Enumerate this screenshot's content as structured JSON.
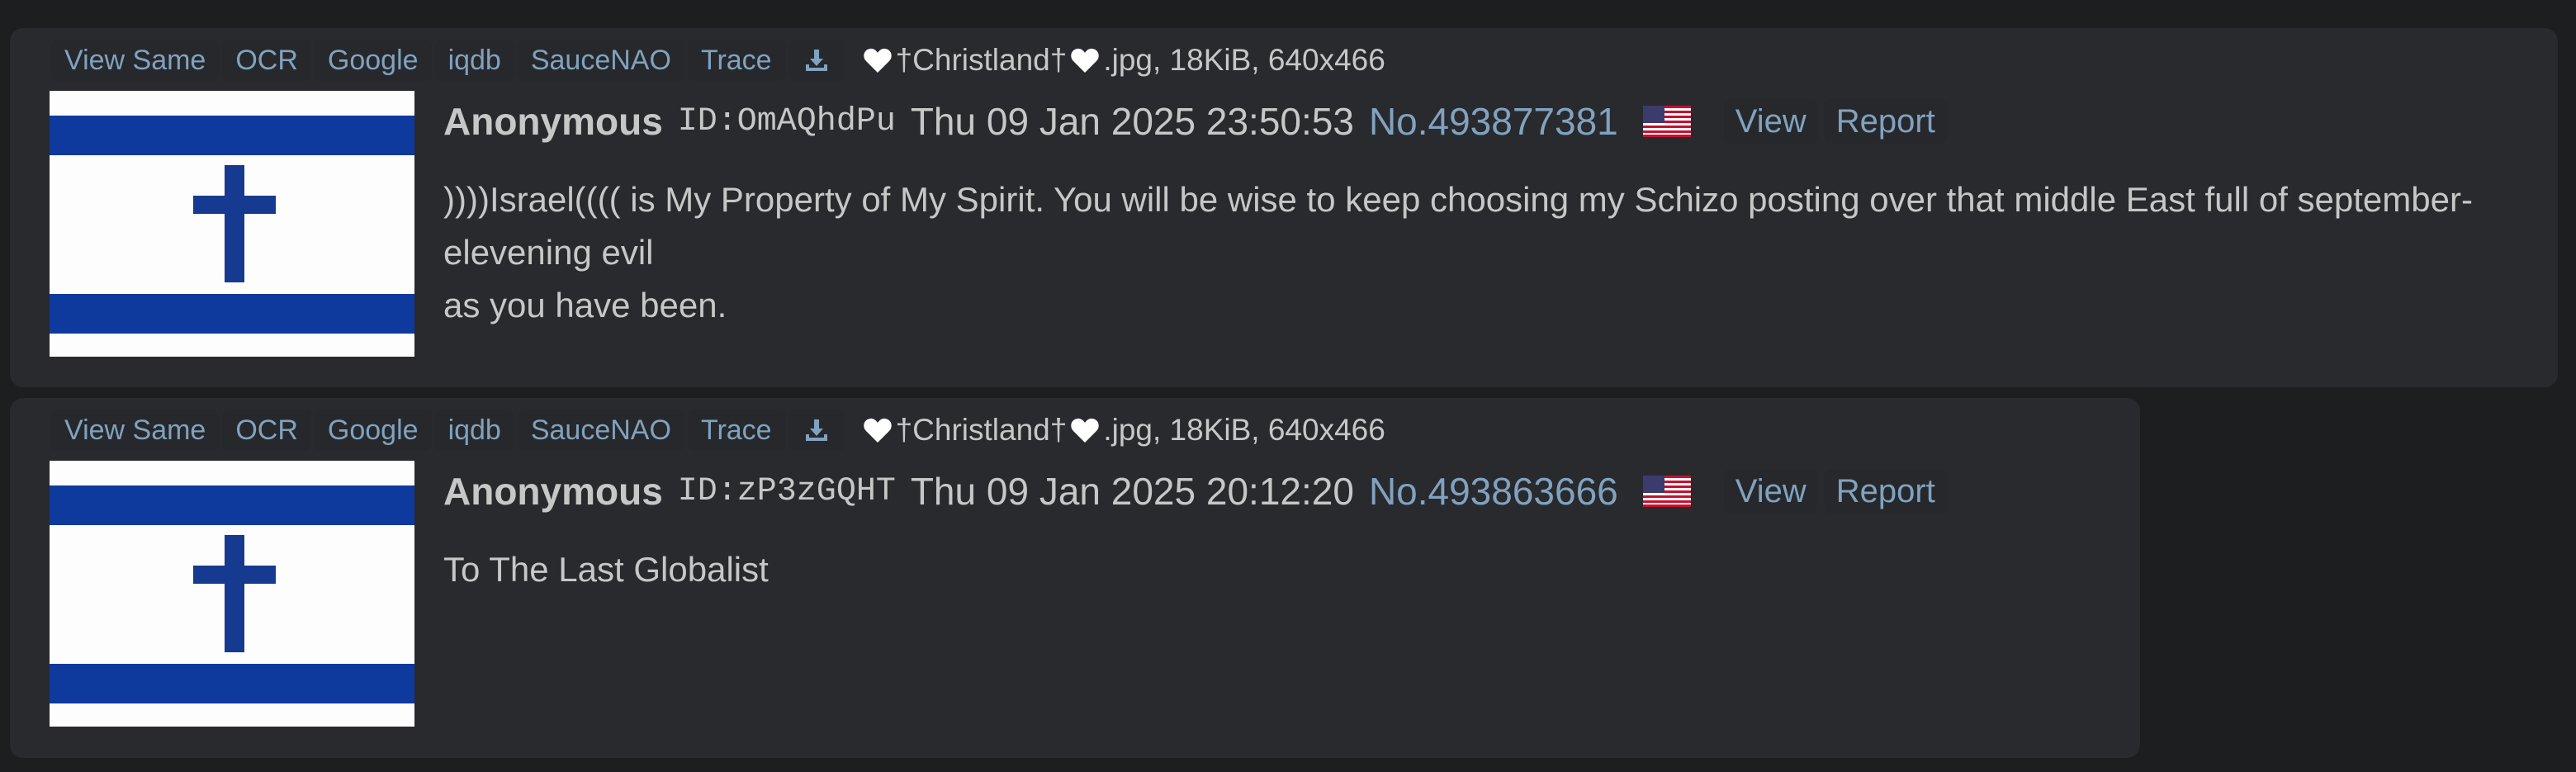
{
  "tools": {
    "view_same": "View Same",
    "ocr": "OCR",
    "google": "Google",
    "iqdb": "iqdb",
    "saucenao": "SauceNAO",
    "trace": "Trace",
    "download_icon": "download-icon"
  },
  "colors": {
    "page_bg": "#1d1e20",
    "post_bg": "#282a2e",
    "text": "#c5c8c6",
    "link": "#81a2be",
    "flag_blue": "#0038b8"
  },
  "posts": [
    {
      "filename": "†Christland†",
      "fileinfo": ".jpg, 18KiB, 640x466",
      "name": "Anonymous",
      "poster_id": "ID:OmAQhdPu",
      "date": "Thu 09 Jan 2025 23:50:53",
      "post_no": "No.493877381",
      "flag_icon": "us-flag-icon",
      "view_label": "View",
      "report_label": "Report",
      "comment_lines": [
        "))))Israel(((( is My Property of My Spirit. You will be wise to keep choosing my Schizo posting over that middle East full of september-elevening evil",
        "as you have been."
      ]
    },
    {
      "filename": "†Christland†",
      "fileinfo": ".jpg, 18KiB, 640x466",
      "name": "Anonymous",
      "poster_id": "ID:zP3zGQHT",
      "date": "Thu 09 Jan 2025 20:12:20",
      "post_no": "No.493863666",
      "flag_icon": "us-flag-icon",
      "view_label": "View",
      "report_label": "Report",
      "comment_lines": [
        "To The Last Globalist"
      ]
    }
  ]
}
